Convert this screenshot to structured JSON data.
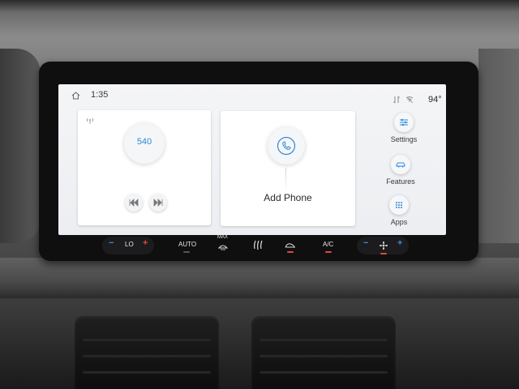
{
  "status_bar": {
    "time": "1:35",
    "outside_temp": "94°"
  },
  "radio": {
    "station": "540"
  },
  "phone": {
    "label": "Add Phone"
  },
  "side_menu": [
    {
      "label": "Settings",
      "icon": "settings-sliders-icon"
    },
    {
      "label": "Features",
      "icon": "car-icon"
    },
    {
      "label": "Apps",
      "icon": "apps-grid-icon"
    }
  ],
  "climate": {
    "left_temp": "LO",
    "auto": "AUTO",
    "max_defrost": "MAX",
    "ac": "A/C"
  },
  "colors": {
    "accent_blue": "#2b8ad6",
    "minus_blue": "#4a82e0",
    "plus_red": "#e0463a",
    "screen_bg": "#f4f5f7"
  }
}
